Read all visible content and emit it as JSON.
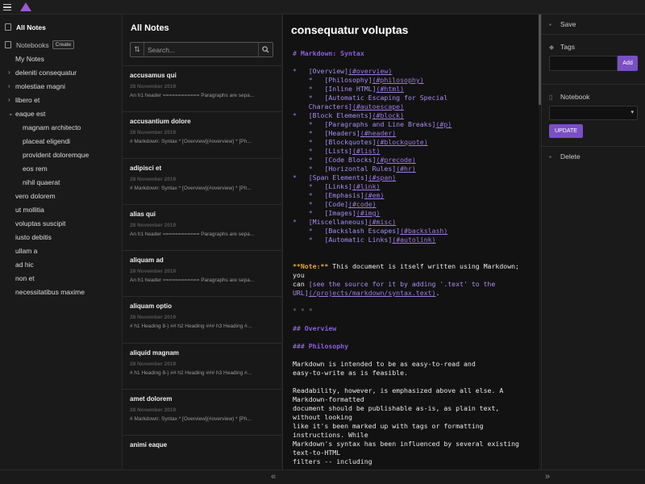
{
  "app": {
    "accent_color": "#7a4fc4",
    "logo_icon": "triangle-logo"
  },
  "sidebar": {
    "all_notes": "All Notes",
    "notebooks_label": "Notebooks",
    "create_label": "Create",
    "items": [
      {
        "label": "My Notes",
        "level": 0,
        "arrow": ""
      },
      {
        "label": "deleniti consequatur",
        "level": 0,
        "arrow": "›"
      },
      {
        "label": "molestiae magni",
        "level": 0,
        "arrow": "›"
      },
      {
        "label": "libero et",
        "level": 0,
        "arrow": "›"
      },
      {
        "label": "eaque est",
        "level": 0,
        "arrow": "⌄"
      },
      {
        "label": "magnam architecto",
        "level": 1,
        "arrow": ""
      },
      {
        "label": "placeat eligendi",
        "level": 1,
        "arrow": ""
      },
      {
        "label": "provident doloremque",
        "level": 1,
        "arrow": ""
      },
      {
        "label": "eos rem",
        "level": 1,
        "arrow": ""
      },
      {
        "label": "nihil quaerat",
        "level": 1,
        "arrow": ""
      },
      {
        "label": "vero dolorem",
        "level": 0,
        "arrow": ""
      },
      {
        "label": "ut mollitia",
        "level": 0,
        "arrow": ""
      },
      {
        "label": "voluptas suscipit",
        "level": 0,
        "arrow": ""
      },
      {
        "label": "iusto debitis",
        "level": 0,
        "arrow": ""
      },
      {
        "label": "ullam a",
        "level": 0,
        "arrow": ""
      },
      {
        "label": "ad hic",
        "level": 0,
        "arrow": ""
      },
      {
        "label": "non et",
        "level": 0,
        "arrow": ""
      },
      {
        "label": "necessitatibus maxime",
        "level": 0,
        "arrow": ""
      }
    ]
  },
  "notelist": {
    "title": "All Notes",
    "search_placeholder": "Search...",
    "notes": [
      {
        "title": "accusamus qui",
        "date": "28 November 2019",
        "preview": "An h1 header ============ Paragraphs are sepa..."
      },
      {
        "title": "accusantium dolore",
        "date": "28 November 2019",
        "preview": "# Markdown: Syntax * [Overview](#overview) * [Ph..."
      },
      {
        "title": "adipisci et",
        "date": "28 November 2019",
        "preview": "# Markdown: Syntax * [Overview](#overview) * [Ph..."
      },
      {
        "title": "alias qui",
        "date": "28 November 2019",
        "preview": "An h1 header ============ Paragraphs are sepa..."
      },
      {
        "title": "aliquam ad",
        "date": "28 November 2019",
        "preview": "An h1 header ============ Paragraphs are sepa..."
      },
      {
        "title": "aliquam optio",
        "date": "28 November 2019",
        "preview": "# h1 Heading 8-) ## h2 Heading ### h3 Heading #..."
      },
      {
        "title": "aliquid magnam",
        "date": "28 November 2019",
        "preview": "# h1 Heading 8-) ## h2 Heading ### h3 Heading #..."
      },
      {
        "title": "amet dolorem",
        "date": "28 November 2019",
        "preview": "# Markdown: Syntax * [Overview](#overview) * [Ph..."
      },
      {
        "title": "animi eaque",
        "date": "",
        "preview": ""
      }
    ]
  },
  "editor": {
    "title": "consequatur voluptas"
  },
  "right_panel": {
    "save_label": "Save",
    "tags_label": "Tags",
    "add_label": "Add",
    "notebook_label": "Notebook",
    "update_label": "UPDATE",
    "delete_label": "Delete"
  }
}
